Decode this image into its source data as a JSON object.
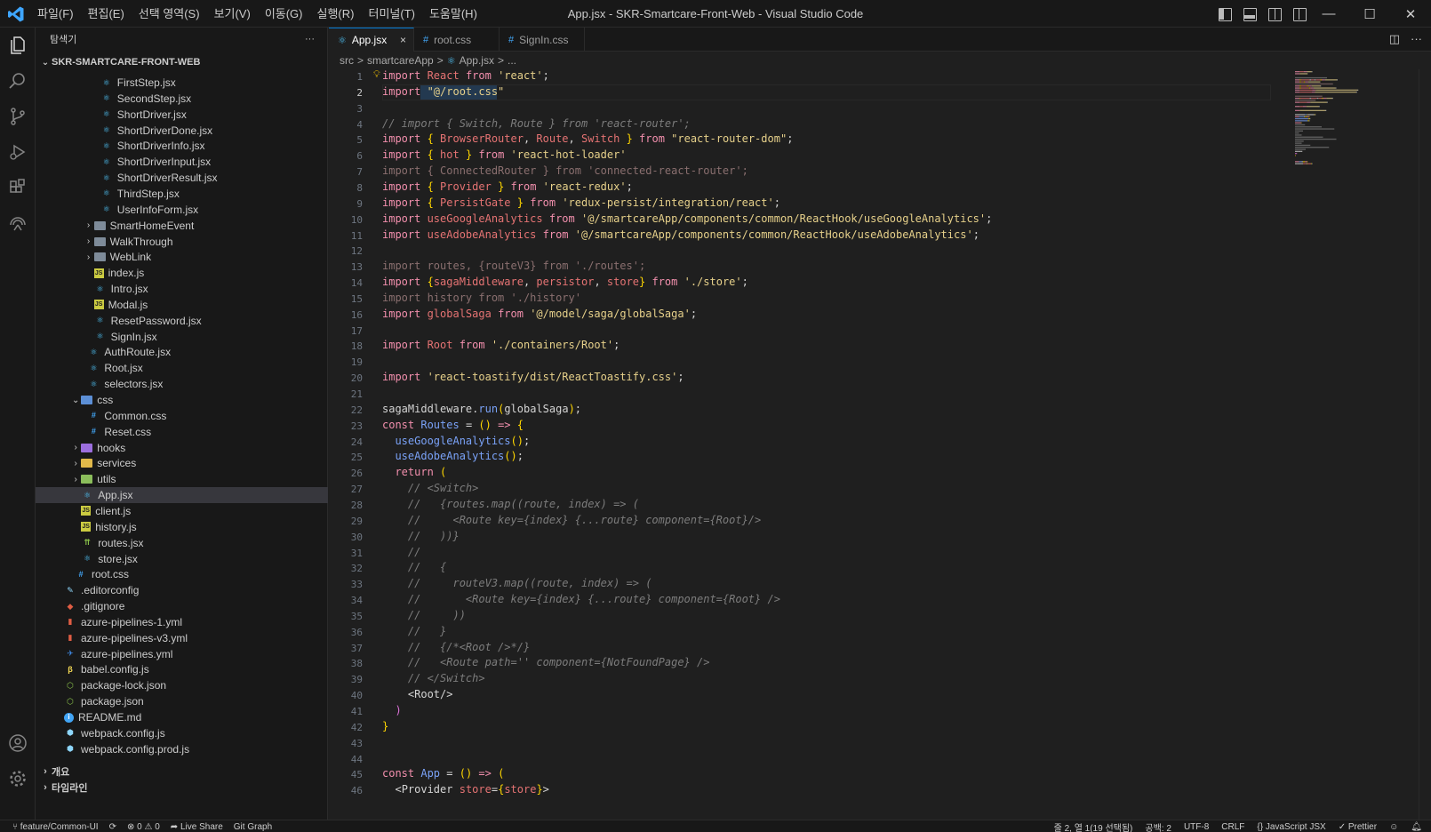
{
  "window": {
    "title": "App.jsx - SKR-Smartcare-Front-Web - Visual Studio Code",
    "menu": [
      "파일(F)",
      "편집(E)",
      "선택 영역(S)",
      "보기(V)",
      "이동(G)",
      "실행(R)",
      "터미널(T)",
      "도움말(H)"
    ],
    "minimize": "—",
    "maximize": "☐",
    "close": "✕"
  },
  "sidebar": {
    "header": "탐색기",
    "more": "···",
    "root": "SKR-SMARTCARE-FRONT-WEB",
    "items": [
      {
        "label": "FirstStep.jsx",
        "icon": "react",
        "depth": 4
      },
      {
        "label": "SecondStep.jsx",
        "icon": "react",
        "depth": 4
      },
      {
        "label": "ShortDriver.jsx",
        "icon": "react",
        "depth": 4
      },
      {
        "label": "ShortDriverDone.jsx",
        "icon": "react",
        "depth": 4
      },
      {
        "label": "ShortDriverInfo.jsx",
        "icon": "react",
        "depth": 4
      },
      {
        "label": "ShortDriverInput.jsx",
        "icon": "react",
        "depth": 4
      },
      {
        "label": "ShortDriverResult.jsx",
        "icon": "react",
        "depth": 4
      },
      {
        "label": "ThirdStep.jsx",
        "icon": "react",
        "depth": 4
      },
      {
        "label": "UserInfoForm.jsx",
        "icon": "react",
        "depth": 4
      },
      {
        "label": "SmartHomeEvent",
        "icon": "folder",
        "depth": 3,
        "chevron": "›"
      },
      {
        "label": "WalkThrough",
        "icon": "folder",
        "depth": 3,
        "chevron": "›"
      },
      {
        "label": "WebLink",
        "icon": "folder",
        "depth": 3,
        "chevron": "›"
      },
      {
        "label": "index.js",
        "icon": "js",
        "depth": 3
      },
      {
        "label": "Intro.jsx",
        "icon": "react",
        "depth": 3
      },
      {
        "label": "Modal.js",
        "icon": "js",
        "depth": 3
      },
      {
        "label": "ResetPassword.jsx",
        "icon": "react",
        "depth": 3
      },
      {
        "label": "SignIn.jsx",
        "icon": "react",
        "depth": 3
      },
      {
        "label": "AuthRoute.jsx",
        "icon": "react",
        "depth": 2
      },
      {
        "label": "Root.jsx",
        "icon": "react",
        "depth": 2
      },
      {
        "label": "selectors.jsx",
        "icon": "react",
        "depth": 2
      },
      {
        "label": "css",
        "icon": "folder-blue",
        "depth": 1,
        "chevron": "⌄"
      },
      {
        "label": "Common.css",
        "icon": "css",
        "depth": 2
      },
      {
        "label": "Reset.css",
        "icon": "css",
        "depth": 2
      },
      {
        "label": "hooks",
        "icon": "folder-purple",
        "depth": 1,
        "chevron": "›"
      },
      {
        "label": "services",
        "icon": "folder-yellow",
        "depth": 1,
        "chevron": "›"
      },
      {
        "label": "utils",
        "icon": "folder-green",
        "depth": 1,
        "chevron": "›"
      },
      {
        "label": "App.jsx",
        "icon": "react",
        "depth": 1,
        "selected": true
      },
      {
        "label": "client.js",
        "icon": "js",
        "depth": 1
      },
      {
        "label": "history.js",
        "icon": "js",
        "depth": 1
      },
      {
        "label": "routes.jsx",
        "icon": "route",
        "depth": 1
      },
      {
        "label": "store.jsx",
        "icon": "react",
        "depth": 1
      },
      {
        "label": "root.css",
        "icon": "css",
        "depth": 0
      },
      {
        "label": ".editorconfig",
        "icon": "editorconfig",
        "depth": -1
      },
      {
        "label": ".gitignore",
        "icon": "git",
        "depth": -1
      },
      {
        "label": "azure-pipelines-1.yml",
        "icon": "yml",
        "depth": -1
      },
      {
        "label": "azure-pipelines-v3.yml",
        "icon": "yml",
        "depth": -1
      },
      {
        "label": "azure-pipelines.yml",
        "icon": "pipeline",
        "depth": -1
      },
      {
        "label": "babel.config.js",
        "icon": "babel",
        "depth": -1
      },
      {
        "label": "package-lock.json",
        "icon": "npm",
        "depth": -1
      },
      {
        "label": "package.json",
        "icon": "npm",
        "depth": -1
      },
      {
        "label": "README.md",
        "icon": "info",
        "depth": -1
      },
      {
        "label": "webpack.config.js",
        "icon": "webpack",
        "depth": -1
      },
      {
        "label": "webpack.config.prod.js",
        "icon": "webpack",
        "depth": -1
      }
    ],
    "outline": "개요",
    "timeline": "타임라인"
  },
  "tabs": [
    {
      "label": "App.jsx",
      "icon": "react",
      "active": true,
      "close": "×"
    },
    {
      "label": "root.css",
      "icon": "css",
      "active": false
    },
    {
      "label": "SignIn.css",
      "icon": "css",
      "active": false
    }
  ],
  "breadcrumb": {
    "parts": [
      "src",
      "smartcareApp",
      "App.jsx",
      "..."
    ],
    "sep": ">"
  },
  "editor": {
    "current_line": 2,
    "lines": [
      [
        {
          "t": "import ",
          "c": "kw"
        },
        {
          "t": "React ",
          "c": "var"
        },
        {
          "t": "from ",
          "c": "kw"
        },
        {
          "t": "'react'",
          "c": "str"
        },
        {
          "t": ";",
          "c": "p"
        }
      ],
      [
        {
          "t": "import ",
          "c": "kw"
        },
        {
          "t": "\"@/root.css\"",
          "c": "str"
        }
      ],
      [],
      [
        {
          "t": "// import { Switch, Route } from 'react-router';",
          "c": "com"
        }
      ],
      [
        {
          "t": "import ",
          "c": "kw"
        },
        {
          "t": "{ ",
          "c": "br"
        },
        {
          "t": "BrowserRouter",
          "c": "var"
        },
        {
          "t": ", ",
          "c": "p"
        },
        {
          "t": "Route",
          "c": "var"
        },
        {
          "t": ", ",
          "c": "p"
        },
        {
          "t": "Switch ",
          "c": "var"
        },
        {
          "t": "} ",
          "c": "br"
        },
        {
          "t": "from ",
          "c": "kw"
        },
        {
          "t": "\"react-router-dom\"",
          "c": "str"
        },
        {
          "t": ";",
          "c": "p"
        }
      ],
      [
        {
          "t": "import ",
          "c": "kw"
        },
        {
          "t": "{ ",
          "c": "br"
        },
        {
          "t": "hot ",
          "c": "var"
        },
        {
          "t": "} ",
          "c": "br"
        },
        {
          "t": "from ",
          "c": "kw"
        },
        {
          "t": "'react-hot-loader'",
          "c": "str"
        }
      ],
      [
        {
          "t": "import { ConnectedRouter } from 'connected-react-router';",
          "c": "dim"
        }
      ],
      [
        {
          "t": "import ",
          "c": "kw"
        },
        {
          "t": "{ ",
          "c": "br"
        },
        {
          "t": "Provider ",
          "c": "var"
        },
        {
          "t": "} ",
          "c": "br"
        },
        {
          "t": "from ",
          "c": "kw"
        },
        {
          "t": "'react-redux'",
          "c": "str"
        },
        {
          "t": ";",
          "c": "p"
        }
      ],
      [
        {
          "t": "import ",
          "c": "kw"
        },
        {
          "t": "{ ",
          "c": "br"
        },
        {
          "t": "PersistGate ",
          "c": "var"
        },
        {
          "t": "} ",
          "c": "br"
        },
        {
          "t": "from ",
          "c": "kw"
        },
        {
          "t": "'redux-persist/integration/react'",
          "c": "str"
        },
        {
          "t": ";",
          "c": "p"
        }
      ],
      [
        {
          "t": "import ",
          "c": "kw"
        },
        {
          "t": "useGoogleAnalytics ",
          "c": "var"
        },
        {
          "t": "from ",
          "c": "kw"
        },
        {
          "t": "'@/smartcareApp/components/common/ReactHook/useGoogleAnalytics'",
          "c": "str"
        },
        {
          "t": ";",
          "c": "p"
        }
      ],
      [
        {
          "t": "import ",
          "c": "kw"
        },
        {
          "t": "useAdobeAnalytics ",
          "c": "var"
        },
        {
          "t": "from ",
          "c": "kw"
        },
        {
          "t": "'@/smartcareApp/components/common/ReactHook/useAdobeAnalytics'",
          "c": "str"
        },
        {
          "t": ";",
          "c": "p"
        }
      ],
      [],
      [
        {
          "t": "import routes, {routeV3} from './routes';",
          "c": "dim"
        }
      ],
      [
        {
          "t": "import ",
          "c": "kw"
        },
        {
          "t": "{",
          "c": "br"
        },
        {
          "t": "sagaMiddleware",
          "c": "var"
        },
        {
          "t": ", ",
          "c": "p"
        },
        {
          "t": "persistor",
          "c": "var"
        },
        {
          "t": ", ",
          "c": "p"
        },
        {
          "t": "store",
          "c": "var"
        },
        {
          "t": "} ",
          "c": "br"
        },
        {
          "t": "from ",
          "c": "kw"
        },
        {
          "t": "'./store'",
          "c": "str"
        },
        {
          "t": ";",
          "c": "p"
        }
      ],
      [
        {
          "t": "import history from './history'",
          "c": "dim"
        }
      ],
      [
        {
          "t": "import ",
          "c": "kw"
        },
        {
          "t": "globalSaga ",
          "c": "var"
        },
        {
          "t": "from ",
          "c": "kw"
        },
        {
          "t": "'@/model/saga/globalSaga'",
          "c": "str"
        },
        {
          "t": ";",
          "c": "p"
        }
      ],
      [],
      [
        {
          "t": "import ",
          "c": "kw"
        },
        {
          "t": "Root ",
          "c": "var"
        },
        {
          "t": "from ",
          "c": "kw"
        },
        {
          "t": "'./containers/Root'",
          "c": "str"
        },
        {
          "t": ";",
          "c": "p"
        }
      ],
      [],
      [
        {
          "t": "import ",
          "c": "kw"
        },
        {
          "t": "'react-toastify/dist/ReactToastify.css'",
          "c": "str"
        },
        {
          "t": ";",
          "c": "p"
        }
      ],
      [],
      [
        {
          "t": "sagaMiddleware",
          "c": "p"
        },
        {
          "t": ".",
          "c": "p"
        },
        {
          "t": "run",
          "c": "fn"
        },
        {
          "t": "(",
          "c": "br"
        },
        {
          "t": "globalSaga",
          "c": "p"
        },
        {
          "t": ")",
          "c": "br"
        },
        {
          "t": ";",
          "c": "p"
        }
      ],
      [
        {
          "t": "const ",
          "c": "kw"
        },
        {
          "t": "Routes ",
          "c": "fn"
        },
        {
          "t": "= ",
          "c": "p"
        },
        {
          "t": "() ",
          "c": "br"
        },
        {
          "t": "=> ",
          "c": "kw"
        },
        {
          "t": "{",
          "c": "br"
        }
      ],
      [
        {
          "t": "  useGoogleAnalytics",
          "c": "fn"
        },
        {
          "t": "()",
          "c": "br"
        },
        {
          "t": ";",
          "c": "p"
        }
      ],
      [
        {
          "t": "  useAdobeAnalytics",
          "c": "fn"
        },
        {
          "t": "()",
          "c": "br"
        },
        {
          "t": ";",
          "c": "p"
        }
      ],
      [
        {
          "t": "  return ",
          "c": "kw"
        },
        {
          "t": "(",
          "c": "br"
        }
      ],
      [
        {
          "t": "    // <Switch>",
          "c": "com"
        }
      ],
      [
        {
          "t": "    //   {routes.map((route, index) => (",
          "c": "com"
        }
      ],
      [
        {
          "t": "    //     <Route key={index} {...route} component={Root}/>",
          "c": "com"
        }
      ],
      [
        {
          "t": "    //   ))}",
          "c": "com"
        }
      ],
      [
        {
          "t": "    //",
          "c": "com"
        }
      ],
      [
        {
          "t": "    //   {",
          "c": "com"
        }
      ],
      [
        {
          "t": "    //     routeV3.map((route, index) => (",
          "c": "com"
        }
      ],
      [
        {
          "t": "    //       <Route key={index} {...route} component={Root} />",
          "c": "com"
        }
      ],
      [
        {
          "t": "    //     ))",
          "c": "com"
        }
      ],
      [
        {
          "t": "    //   }",
          "c": "com"
        }
      ],
      [
        {
          "t": "    //   {/*<Root />*/}",
          "c": "com"
        }
      ],
      [
        {
          "t": "    //   <Route path='' component={NotFoundPage} />",
          "c": "com"
        }
      ],
      [
        {
          "t": "    // </Switch>",
          "c": "com"
        }
      ],
      [
        {
          "t": "    <",
          "c": "p"
        },
        {
          "t": "Root",
          "c": "tag"
        },
        {
          "t": "/>",
          "c": "p"
        }
      ],
      [
        {
          "t": "  )",
          "c": "br2"
        }
      ],
      [
        {
          "t": "}",
          "c": "br"
        }
      ],
      [],
      [],
      [
        {
          "t": "const ",
          "c": "kw"
        },
        {
          "t": "App ",
          "c": "fn"
        },
        {
          "t": "= ",
          "c": "p"
        },
        {
          "t": "() ",
          "c": "br"
        },
        {
          "t": "=> ",
          "c": "kw"
        },
        {
          "t": "(",
          "c": "br"
        }
      ],
      [
        {
          "t": "  <",
          "c": "p"
        },
        {
          "t": "Provider ",
          "c": "tag"
        },
        {
          "t": "store",
          "c": "var"
        },
        {
          "t": "=",
          "c": "p"
        },
        {
          "t": "{",
          "c": "br"
        },
        {
          "t": "store",
          "c": "var"
        },
        {
          "t": "}",
          "c": "br"
        },
        {
          "t": ">",
          "c": "p"
        }
      ]
    ]
  },
  "colors": {
    "kw": "#f28fad",
    "str": "#e6d08a",
    "var": "#e57373",
    "fn": "#7aa2f7",
    "com": "#7c7c7c",
    "dim": "#8a6f6f",
    "br": "#ffd700",
    "br2": "#da70d6",
    "p": "#d4d4d4",
    "tag": "#d4d4d4",
    "accent": "#0078d4"
  },
  "status": {
    "branch": "feature/Common-UI",
    "sync": "⟳",
    "errors": "⊗ 0 ⚠ 0",
    "liveshare": "Live Share",
    "gitgraph": "Git Graph",
    "position": "줄 2, 열 1(19 선택됨)",
    "spaces": "공백: 2",
    "encoding": "UTF-8",
    "eol": "CRLF",
    "language": "JavaScript JSX",
    "prettier": "✓ Prettier"
  }
}
